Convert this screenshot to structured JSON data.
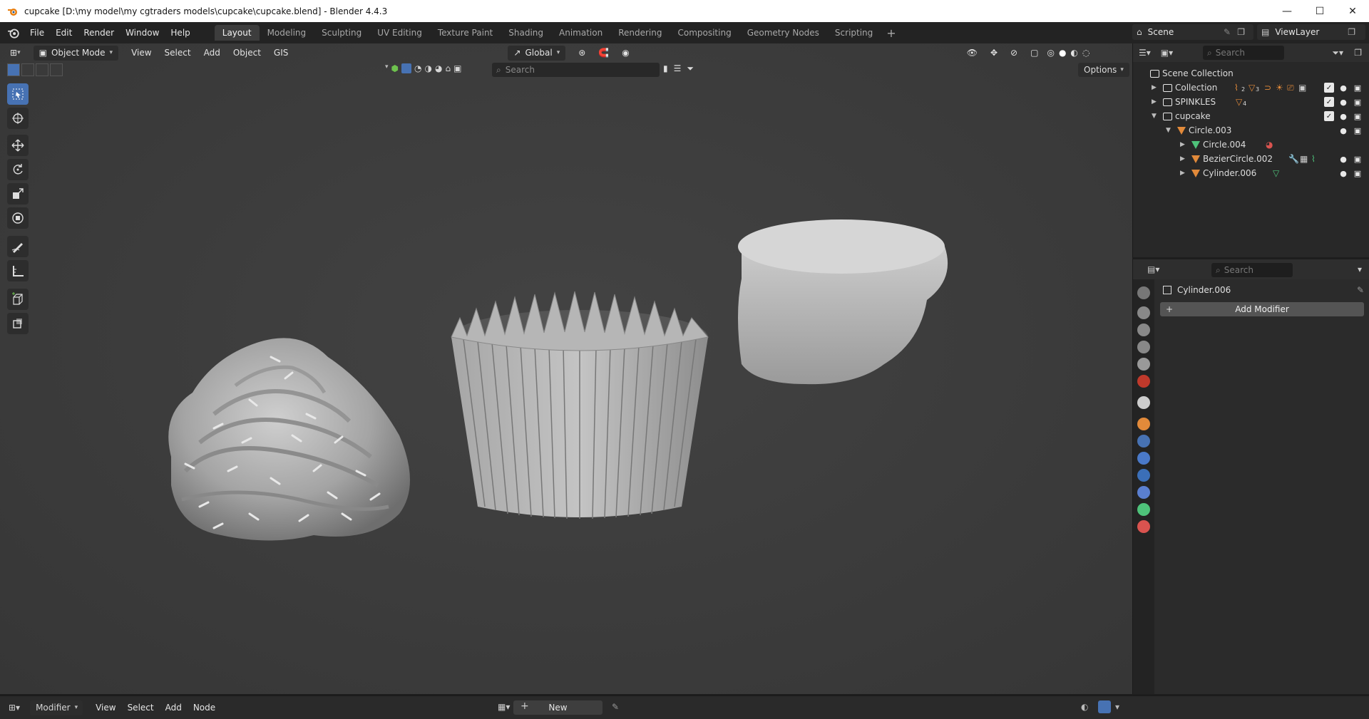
{
  "window": {
    "title": "cupcake [D:\\my model\\my cgtraders models\\cupcake\\cupcake.blend] - Blender 4.4.3",
    "minimize": "—",
    "maximize": "☐",
    "close": "✕"
  },
  "menu": [
    "File",
    "Edit",
    "Render",
    "Window",
    "Help"
  ],
  "workspaces": {
    "active": "Layout",
    "tabs": [
      "Layout",
      "Modeling",
      "Sculpting",
      "UV Editing",
      "Texture Paint",
      "Shading",
      "Animation",
      "Rendering",
      "Compositing",
      "Geometry Nodes",
      "Scripting"
    ],
    "add": "+"
  },
  "scene": {
    "label": "Scene"
  },
  "viewlayer": {
    "label": "ViewLayer"
  },
  "viewport": {
    "mode": "Object Mode",
    "menu": [
      "View",
      "Select",
      "Add",
      "Object",
      "GIS"
    ],
    "orientation": "Global",
    "search_placeholder": "Search",
    "options": "Options"
  },
  "outliner": {
    "search_placeholder": "Search",
    "root": "Scene Collection",
    "rows": [
      {
        "label": "Collection",
        "type": "collection",
        "depth": 0,
        "expanded": false
      },
      {
        "label": "SPINKLES",
        "type": "collection",
        "depth": 0,
        "expanded": false
      },
      {
        "label": "cupcake",
        "type": "collection",
        "depth": 0,
        "expanded": true
      },
      {
        "label": "Circle.003",
        "type": "object",
        "depth": 1,
        "expanded": true
      },
      {
        "label": "Circle.004",
        "type": "mesh",
        "depth": 2,
        "expanded": false
      },
      {
        "label": "BezierCircle.002",
        "type": "object",
        "depth": 2,
        "expanded": false
      },
      {
        "label": "Cylinder.006",
        "type": "object",
        "depth": 2,
        "expanded": false
      }
    ],
    "badges": {
      "collection_count_a": "2",
      "collection_count_b": "3",
      "spinkles_count": "4"
    }
  },
  "properties": {
    "search_placeholder": "Search",
    "object_name": "Cylinder.006",
    "add_modifier": "Add Modifier"
  },
  "bottom": {
    "editor": "Modifier",
    "menu": [
      "View",
      "Select",
      "Add",
      "Node"
    ],
    "new_button": "New"
  },
  "colors": {
    "accent": "#4772b3",
    "object_orange": "#e28a3a",
    "mesh_green": "#4ec27a"
  }
}
